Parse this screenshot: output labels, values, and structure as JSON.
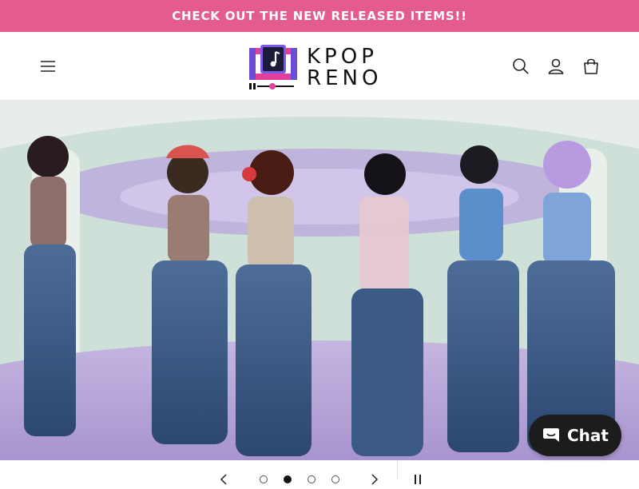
{
  "announcement": {
    "text": "CHECK OUT THE NEW RELEASED ITEMS!!"
  },
  "header": {
    "logo": {
      "line1": "KPOP",
      "line2": "RENO"
    },
    "icons": {
      "menu": "hamburger-menu-icon",
      "search": "search-icon",
      "account": "account-login-icon",
      "cart": "shopping-bag-icon"
    }
  },
  "hero": {
    "image": "group-photo-five-women-denim-outfits",
    "slide_count": 4,
    "active_slide": 2
  },
  "slider": {
    "icons": {
      "prev": "chevron-left-icon",
      "next": "chevron-right-icon",
      "pause": "pause-icon"
    }
  },
  "chat_widget": {
    "label": "Chat",
    "icon": "chat-bubble-icon"
  },
  "colors": {
    "announcement_bg": "#e35b8f",
    "chat_bg": "#1c1c1c",
    "logo_pink": "#e0409a",
    "logo_purple": "#6b4bd8"
  }
}
